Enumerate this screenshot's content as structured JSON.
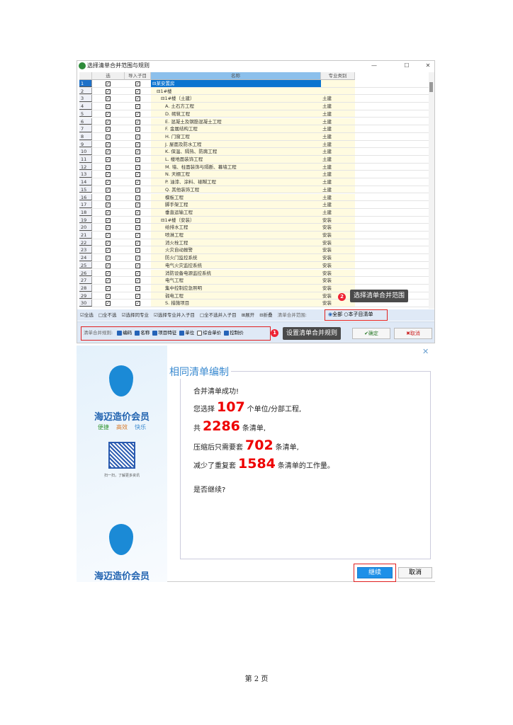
{
  "window": {
    "title": "选择清单合并范围与规则",
    "min": "—",
    "max": "☐",
    "close": "✕"
  },
  "grid": {
    "headers": [
      "选",
      "导入子目",
      "名称",
      "专业类别"
    ],
    "rows": [
      {
        "n": "1",
        "name": "⊟某安置房",
        "spec": ""
      },
      {
        "n": "2",
        "name": "⊟1#楼",
        "spec": ""
      },
      {
        "n": "3",
        "name": "⊟1#楼（土建）",
        "spec": "土建"
      },
      {
        "n": "4",
        "name": "A. 土石方工程",
        "spec": "土建"
      },
      {
        "n": "5",
        "name": "D. 砌筑工程",
        "spec": "土建"
      },
      {
        "n": "6",
        "name": "E. 混凝土及钢筋混凝土工程",
        "spec": "土建"
      },
      {
        "n": "7",
        "name": "F. 金属结构工程",
        "spec": "土建"
      },
      {
        "n": "8",
        "name": "H. 门窗工程",
        "spec": "土建"
      },
      {
        "n": "9",
        "name": "J. 屋面及防水工程",
        "spec": "土建"
      },
      {
        "n": "10",
        "name": "K. 保温、隔热、防腐工程",
        "spec": "土建"
      },
      {
        "n": "11",
        "name": "L. 楼地面装饰工程",
        "spec": "土建"
      },
      {
        "n": "12",
        "name": "M. 墙、柱面装饰与隔断、幕墙工程",
        "spec": "土建"
      },
      {
        "n": "13",
        "name": "N. 天棚工程",
        "spec": "土建"
      },
      {
        "n": "14",
        "name": "P. 油漆、涂料、裱糊工程",
        "spec": "土建"
      },
      {
        "n": "15",
        "name": "Q. 其他装饰工程",
        "spec": "土建"
      },
      {
        "n": "16",
        "name": "模板工程",
        "spec": "土建"
      },
      {
        "n": "17",
        "name": "脚手架工程",
        "spec": "土建"
      },
      {
        "n": "18",
        "name": "垂直运输工程",
        "spec": "土建"
      },
      {
        "n": "19",
        "name": "⊟1#楼（安装）",
        "spec": "安装"
      },
      {
        "n": "20",
        "name": "给排水工程",
        "spec": "安装"
      },
      {
        "n": "21",
        "name": "喷淋工程",
        "spec": "安装"
      },
      {
        "n": "22",
        "name": "消火栓工程",
        "spec": "安装"
      },
      {
        "n": "23",
        "name": "火灾自动报警",
        "spec": "安装"
      },
      {
        "n": "24",
        "name": "防火门监控系统",
        "spec": "安装"
      },
      {
        "n": "25",
        "name": "电气火灾监控系统",
        "spec": "安装"
      },
      {
        "n": "26",
        "name": "消防设备电源监控系统",
        "spec": "安装"
      },
      {
        "n": "27",
        "name": "电气工程",
        "spec": "安装"
      },
      {
        "n": "28",
        "name": "集中控制应急照明",
        "spec": "安装"
      },
      {
        "n": "29",
        "name": "弱电工程",
        "spec": "安装"
      },
      {
        "n": "30",
        "name": "S. 措施项目",
        "spec": "安装"
      }
    ]
  },
  "toolbar": {
    "select_all": "☑全选",
    "select_none": "□全不选",
    "select_same": "☑选择同专业",
    "select_merge": "☑选择专业并入子目",
    "none_merge": "□全不选并入子目",
    "expand": "⊞展开",
    "collapse": "⊟折叠",
    "range_label": "清单合并范围:",
    "range_all": "全部",
    "range_sub": "本子目清单"
  },
  "rules": {
    "label": "清单合并规则:",
    "items": [
      {
        "label": "编码",
        "checked": true
      },
      {
        "label": "名称",
        "checked": true
      },
      {
        "label": "项目特征",
        "checked": true
      },
      {
        "label": "单位",
        "checked": true
      },
      {
        "label": "综合单价",
        "checked": false
      },
      {
        "label": "控制价",
        "checked": true
      }
    ],
    "ok": "✔确定",
    "cancel": "✖取消"
  },
  "callouts": [
    {
      "num": "1",
      "text": "设置清单合并规则"
    },
    {
      "num": "2",
      "text": "选择清单合并范围"
    }
  ],
  "dialog": {
    "close": "✕",
    "brand": "海迈造价会员",
    "slogan": [
      "便捷",
      "高效",
      "快乐"
    ],
    "qr_caption": "扫一扫，了解更多资讯",
    "title": "相同清单编制",
    "success": "合并清单成功!",
    "l1a": "您选择",
    "units": "107",
    "l1b": "个单位/分部工程,",
    "l2a": "共",
    "lists": "2286",
    "l2b": "条清单,",
    "l3a": "压缩后只需要套",
    "compressed": "702",
    "l3b": "条清单,",
    "l4a": "减少了重复套",
    "reduced": "1584",
    "l4b": "条清单的工作量。",
    "question": "是否继续?",
    "continue": "继续",
    "cancel": "取消"
  },
  "footer": "第 2 页"
}
